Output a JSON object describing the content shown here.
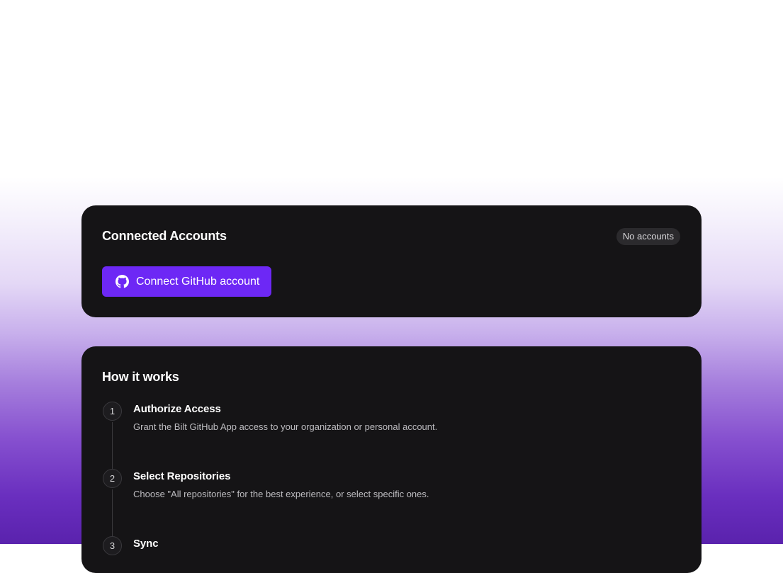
{
  "accounts": {
    "title": "Connected Accounts",
    "badge": "No accounts",
    "connect_label": "Connect GitHub account",
    "connect_icon": "github-icon"
  },
  "how": {
    "title": "How it works",
    "steps": [
      {
        "number": "1",
        "title": "Authorize Access",
        "description": "Grant the Bilt GitHub App access to your organization or personal account."
      },
      {
        "number": "2",
        "title": "Select Repositories",
        "description": "Choose \"All repositories\" for the best experience, or select specific ones."
      },
      {
        "number": "3",
        "title": "Sync",
        "description": ""
      }
    ]
  },
  "colors": {
    "card_bg": "#151416",
    "accent": "#6d28f5",
    "badge_bg": "#2b2a2d"
  }
}
